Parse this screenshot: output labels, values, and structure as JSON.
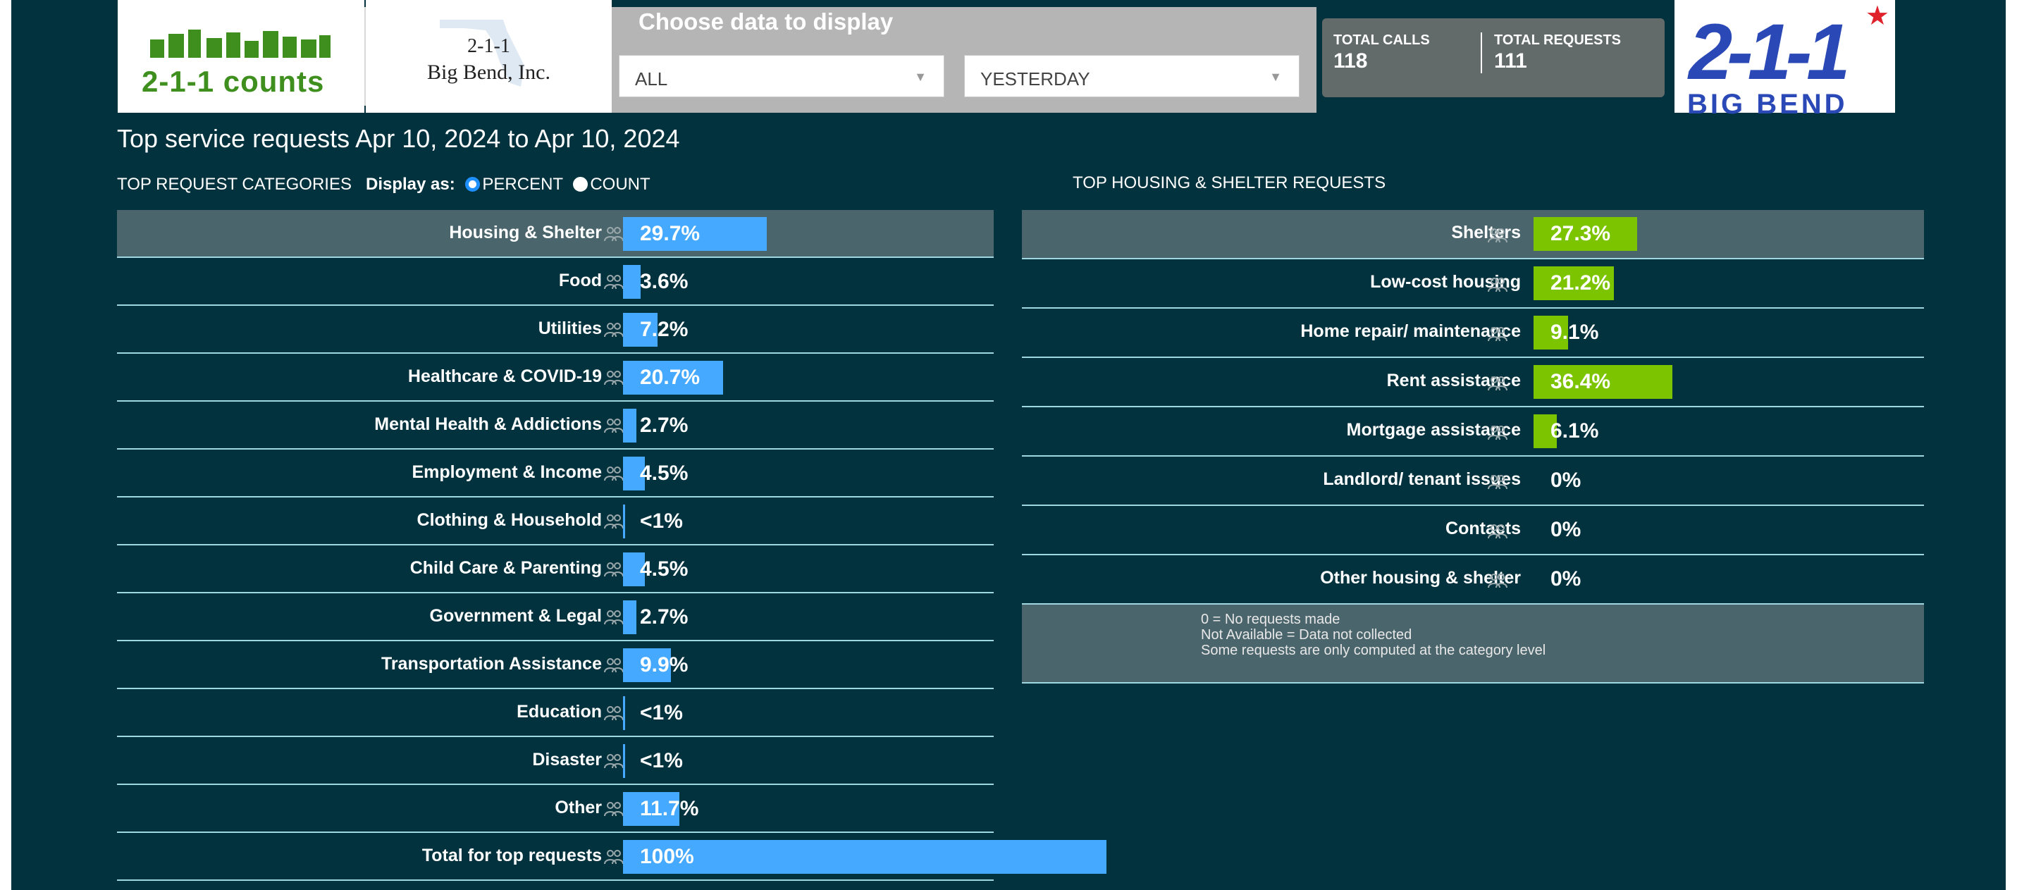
{
  "header": {
    "counts_logo_text": "2-1-1 counts",
    "partner_logo_line1": "2-1-1",
    "partner_logo_line2": "Big Bend, Inc.",
    "choose_title": "Choose data to display",
    "filter_category": "ALL",
    "filter_period": "YESTERDAY",
    "total_calls_label": "TOTAL CALLS",
    "total_calls_value": "118",
    "total_requests_label": "TOTAL REQUESTS",
    "total_requests_value": "111",
    "brand_logo_number": "2-1-1",
    "brand_logo_text": "BIG BEND"
  },
  "title": "Top service requests Apr 10, 2024 to Apr 10, 2024",
  "categories_section": {
    "heading": "TOP REQUEST CATEGORIES",
    "display_as_label": "Display as:",
    "option_percent": "PERCENT",
    "option_count": "COUNT",
    "selected": "PERCENT",
    "bar_color": "#45a9ff",
    "rows": [
      {
        "label": "Housing & Shelter",
        "value": "29.7%",
        "pct": 29.7,
        "highlight": true
      },
      {
        "label": "Food",
        "value": "3.6%",
        "pct": 3.6
      },
      {
        "label": "Utilities",
        "value": "7.2%",
        "pct": 7.2
      },
      {
        "label": "Healthcare & COVID-19",
        "value": "20.7%",
        "pct": 20.7
      },
      {
        "label": "Mental Health & Addictions",
        "value": "2.7%",
        "pct": 2.7
      },
      {
        "label": "Employment & Income",
        "value": "4.5%",
        "pct": 4.5
      },
      {
        "label": "Clothing & Household",
        "value": "<1%",
        "pct": 0
      },
      {
        "label": "Child Care & Parenting",
        "value": "4.5%",
        "pct": 4.5
      },
      {
        "label": "Government & Legal",
        "value": "2.7%",
        "pct": 2.7
      },
      {
        "label": "Transportation Assistance",
        "value": "9.9%",
        "pct": 9.9
      },
      {
        "label": "Education",
        "value": "<1%",
        "pct": 0
      },
      {
        "label": "Disaster",
        "value": "<1%",
        "pct": 0
      },
      {
        "label": "Other",
        "value": "11.7%",
        "pct": 11.7
      },
      {
        "label": "Total for top requests",
        "value": "100%",
        "pct": 100
      }
    ]
  },
  "housing_section": {
    "heading": "TOP HOUSING & SHELTER REQUESTS",
    "bar_color": "#7dc400",
    "rows": [
      {
        "label": "Shelters",
        "value": "27.3%",
        "pct": 27.3
      },
      {
        "label": "Low-cost housing",
        "value": "21.2%",
        "pct": 21.2
      },
      {
        "label": "Home repair/ maintenance",
        "value": "9.1%",
        "pct": 9.1
      },
      {
        "label": "Rent assistance",
        "value": "36.4%",
        "pct": 36.4
      },
      {
        "label": "Mortgage assistance",
        "value": "6.1%",
        "pct": 6.1
      },
      {
        "label": "Landlord/ tenant issues",
        "value": "0%",
        "pct": 0
      },
      {
        "label": "Contacts",
        "value": "0%",
        "pct": 0
      },
      {
        "label": "Other housing & shelter",
        "value": "0%",
        "pct": 0
      }
    ],
    "notes": [
      "0 = No requests made",
      "Not Available = Data not collected",
      "Some requests are only computed at the category level"
    ]
  }
}
